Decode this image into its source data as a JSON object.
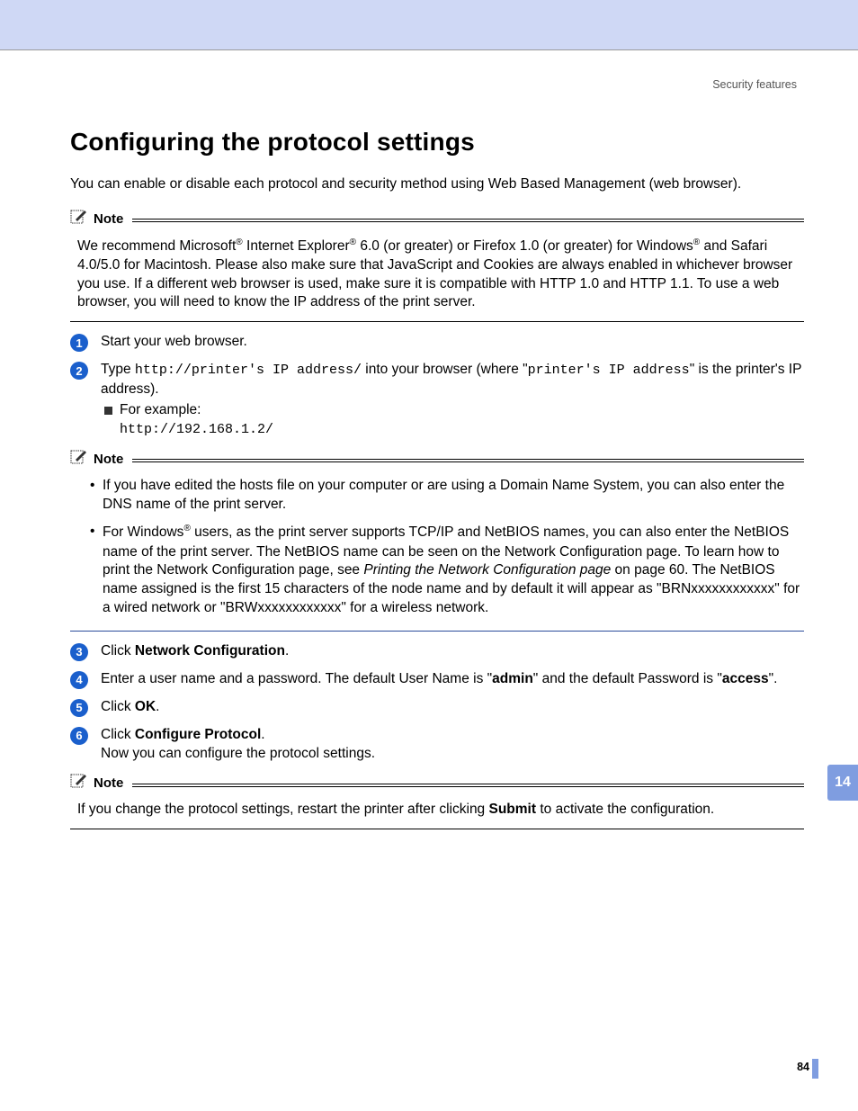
{
  "header_label": "Security features",
  "heading": "Configuring the protocol settings",
  "intro": "You can enable or disable each protocol and security method using Web Based Management (web browser).",
  "notes": {
    "label": "Note",
    "n1": {
      "p1_a": "We recommend Microsoft",
      "p1_b": " Internet Explorer",
      "p1_c": " 6.0 (or greater) or Firefox 1.0 (or greater) for Windows",
      "p1_d": " and Safari 4.0/5.0 for Macintosh. Please also make sure that JavaScript and Cookies are always enabled in whichever browser you use. If a different web browser is used, make sure it is compatible with HTTP 1.0 and HTTP 1.1. To use a web browser, you will need to know the IP address of the print server."
    },
    "n2": {
      "b1": "If you have edited the hosts file on your computer or are using a Domain Name System, you can also enter the DNS name of the print server.",
      "b2_a": "For Windows",
      "b2_b": " users, as the print server supports TCP/IP and NetBIOS names, you can also enter the NetBIOS name of the print server. The NetBIOS name can be seen on the Network Configuration page. To learn how to print the Network Configuration page, see ",
      "b2_c": "Printing the Network Configuration page",
      "b2_d": " on page 60. The NetBIOS name assigned is the first 15 characters of the node name and by default it will appear as \"BRNxxxxxxxxxxxx\" for a wired network or \"BRWxxxxxxxxxxxx\" for a wireless network."
    },
    "n3_a": "If you change the protocol settings, restart the printer after clicking ",
    "n3_b": "Submit",
    "n3_c": " to activate the configuration."
  },
  "steps": {
    "s1": "Start your web browser.",
    "s2_a": "Type ",
    "s2_code1": "http://printer's IP address/",
    "s2_b": " into your browser (where \"",
    "s2_code2": "printer's IP address",
    "s2_c": "\" is the printer's IP address).",
    "s2_sub": "For example:",
    "s2_example": "http://192.168.1.2/",
    "s3_a": "Click ",
    "s3_b": "Network Configuration",
    "s3_c": ".",
    "s4_a": "Enter a user name and a password. The default User Name is \"",
    "s4_b": "admin",
    "s4_c": "\" and the default Password is \"",
    "s4_d": "access",
    "s4_e": "\".",
    "s5_a": "Click ",
    "s5_b": "OK",
    "s5_c": ".",
    "s6_a": "Click ",
    "s6_b": "Configure Protocol",
    "s6_c": ".",
    "s6_d": "Now you can configure the protocol settings."
  },
  "badges": {
    "b1": "1",
    "b2": "2",
    "b3": "3",
    "b4": "4",
    "b5": "5",
    "b6": "6"
  },
  "side_tab": "14",
  "page_number": "84"
}
